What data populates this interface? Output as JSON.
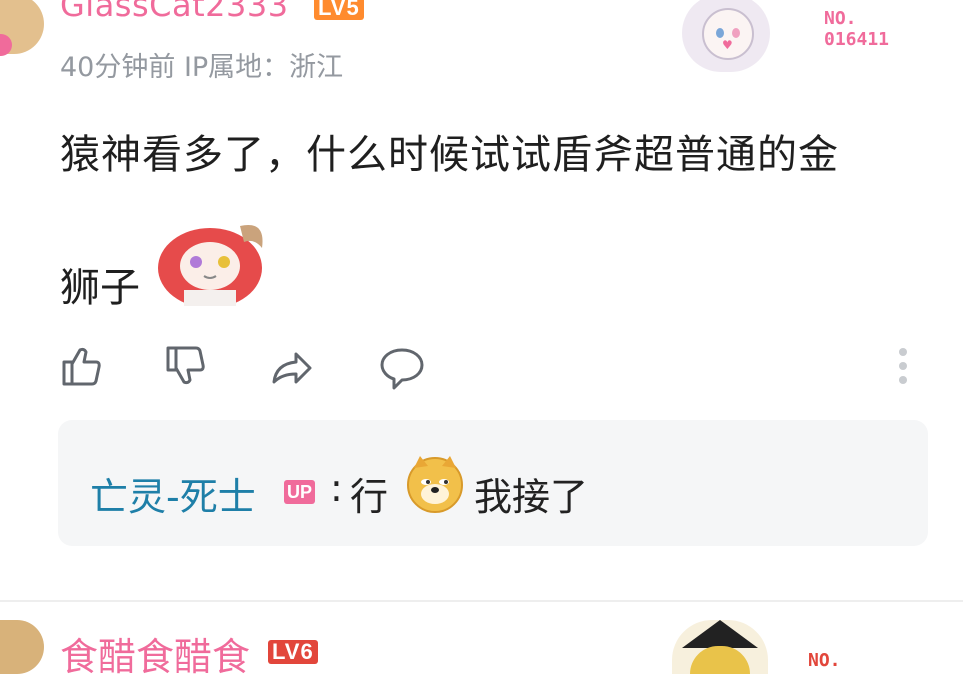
{
  "comment": {
    "user": {
      "name": "GlassCat2333",
      "level": "LV5",
      "badge_no": "NO.\n016411"
    },
    "meta": "40分钟前 IP属地：浙江",
    "text_line1": "猿神看多了，什么时候试试盾斧超普通的金",
    "text_line2": "狮子",
    "sticker_icon": "sticker-girl-icon",
    "actions": {
      "like": "like-icon",
      "dislike": "dislike-icon",
      "share": "share-icon",
      "reply": "reply-icon",
      "more": "more-icon"
    },
    "reply": {
      "author": "亡灵-死士",
      "author_badge": "UP",
      "colon": ":",
      "text_before": "行",
      "emoji": "doge-icon",
      "text_after": "我接了"
    }
  },
  "next_comment": {
    "user": {
      "name": "食醋食醋食",
      "level": "LV6",
      "badge_no": "NO."
    }
  },
  "colors": {
    "username": "#f06b9b",
    "lv5": "#ff8b2e",
    "lv6": "#e2463b",
    "reply_author": "#1e7fa8",
    "meta": "#9499a0",
    "reply_bg": "#f5f6f7"
  }
}
